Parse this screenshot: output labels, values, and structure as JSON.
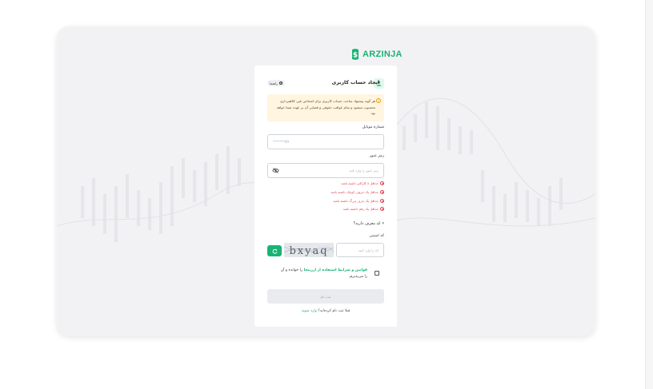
{
  "brand": {
    "logo_text": "ARZINJA",
    "accent": "#19b373"
  },
  "form": {
    "title": "ایجاد حساب کاربری",
    "guide_label": "راهنما",
    "warning_text": "هر گونه پیشنهاد ساخت حساب کاربری برای اشخاص غیر، کلاهبرداری محسوب میشود و تمام عواقب حقوقی و قضایی آن بر عهده شما خواهد بود.",
    "mobile_label": "شماره موبایل",
    "mobile_placeholder": "09*******",
    "password_label": "رمز عبور",
    "password_placeholder": "رمز عبور را وارد کنید",
    "requirements": [
      "حداقل ۸ کاراکتر داشته باشد",
      "حداقل یک حروف کوچک داشته باشد",
      "حداقل یک حرف بزرگ داشته باشد",
      "حداقل یک رقم داشته باشد"
    ],
    "referral_label": "کد معرف دارید؟",
    "captcha_label": "کد امنیتی",
    "captcha_placeholder": "کد را وارد کنید",
    "captcha_text": "bxyaq",
    "terms_link": "قوانین و شرایط استفاده از ارزینجا",
    "terms_rest": " را خوانده و آن را می‌پذیرم.",
    "submit_label": "ثبت نام",
    "footer_text": "قبلا ثبت نام کرده‌اید؟",
    "footer_link": "وارد شوید"
  }
}
